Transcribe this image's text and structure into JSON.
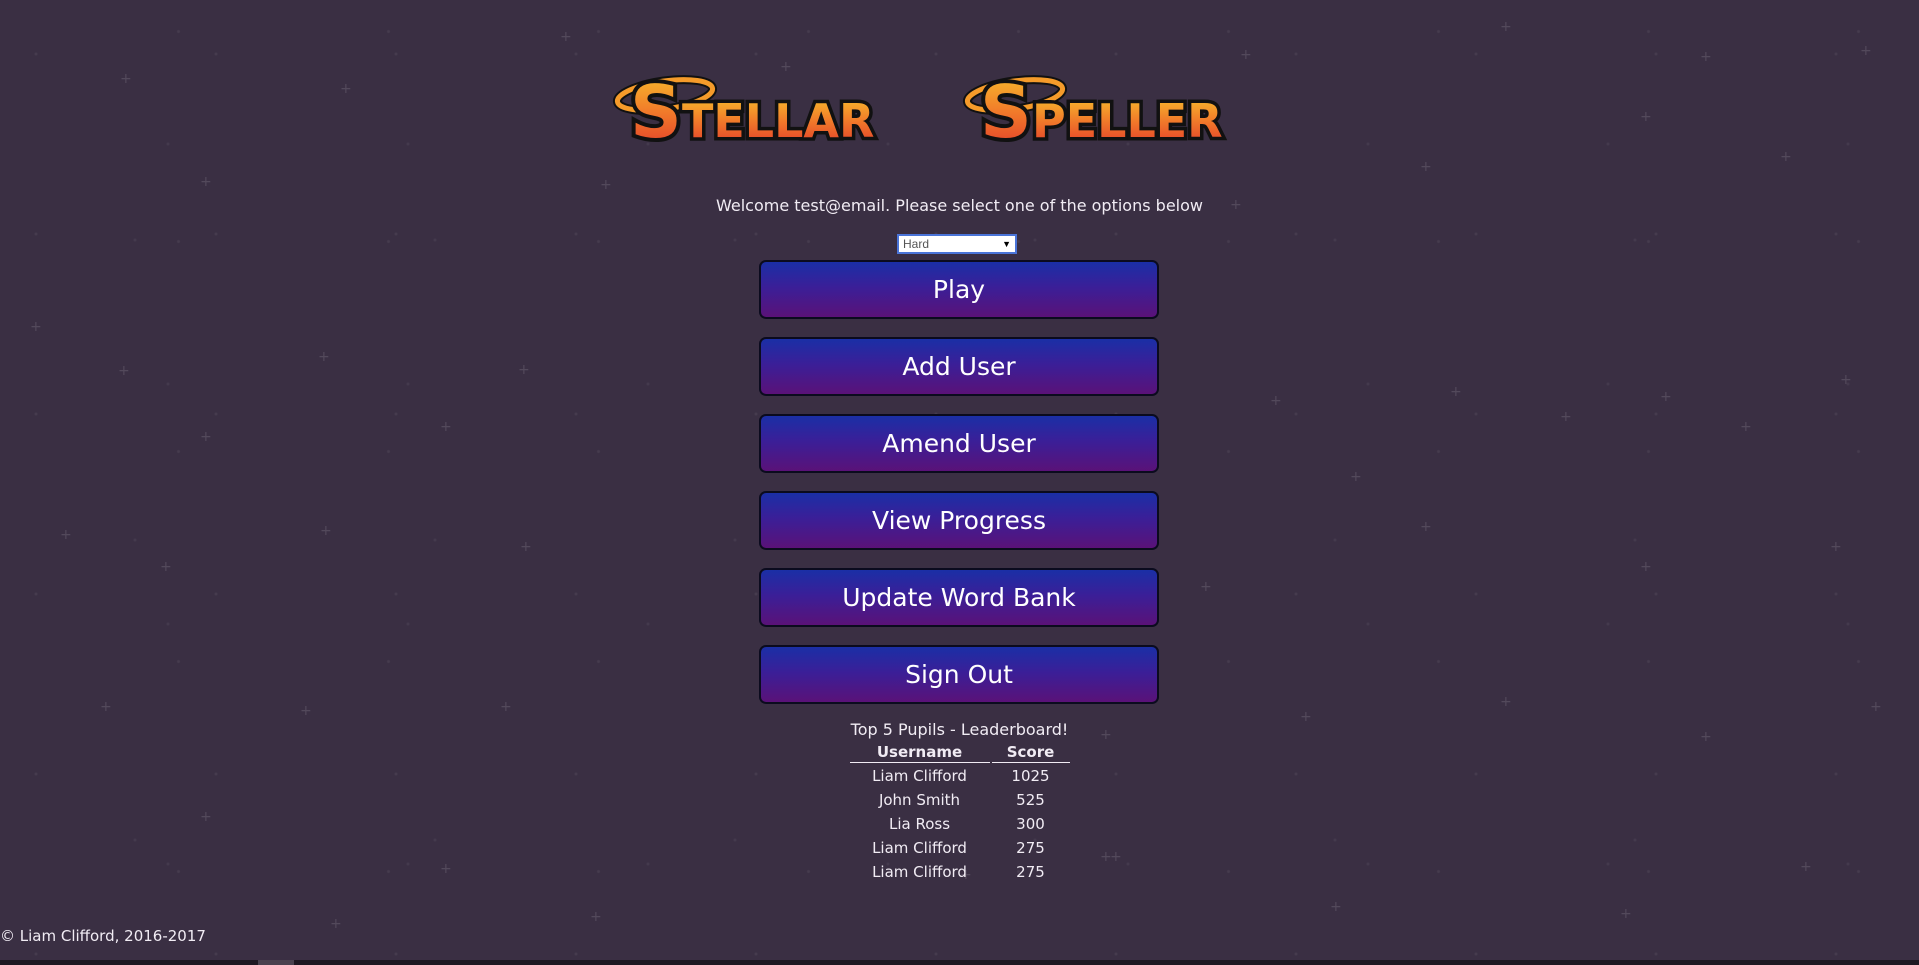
{
  "logo": {
    "word1": "STELLAR",
    "word2": "SPELLER"
  },
  "welcome_text": "Welcome test@email. Please select one of the options below",
  "difficulty": {
    "selected": "Hard"
  },
  "menu": {
    "play": "Play",
    "add_user": "Add User",
    "amend_user": "Amend User",
    "view_progress": "View Progress",
    "update_word_bank": "Update Word Bank",
    "sign_out": "Sign Out"
  },
  "leaderboard": {
    "title": "Top 5 Pupils - Leaderboard!",
    "headers": [
      "Username",
      "Score"
    ],
    "rows": [
      [
        "Liam Clifford",
        "1025"
      ],
      [
        "John Smith",
        "525"
      ],
      [
        "Lia Ross",
        "300"
      ],
      [
        "Liam Clifford",
        "275"
      ],
      [
        "Liam Clifford",
        "275"
      ]
    ]
  },
  "footer": "© Liam Clifford, 2016-2017",
  "colors": {
    "background": "#3a2f43",
    "button_top": "#1a2fa6",
    "button_bottom": "#5a1278",
    "logo_fill_top": "#f6b22a",
    "logo_fill_bottom": "#e8402a"
  }
}
